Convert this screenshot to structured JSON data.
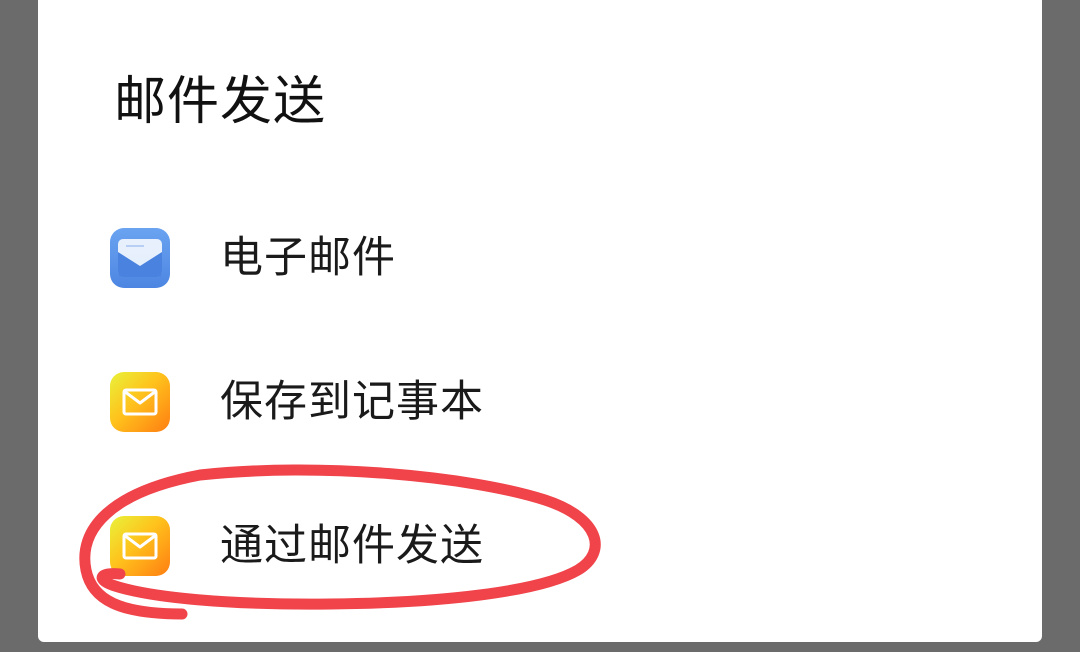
{
  "dialog": {
    "title": "邮件发送",
    "options": [
      {
        "label": "电子邮件",
        "icon": "email-app-icon",
        "icon_color": "#5a94ea"
      },
      {
        "label": "保存到记事本",
        "icon": "mail-envelope-icon",
        "icon_color": "#ffb21a"
      },
      {
        "label": "通过邮件发送",
        "icon": "mail-envelope-icon",
        "icon_color": "#ffb21a"
      }
    ]
  },
  "annotation": {
    "color": "#f0434a",
    "shape": "hand-drawn-circle",
    "target": "通过邮件发送"
  }
}
